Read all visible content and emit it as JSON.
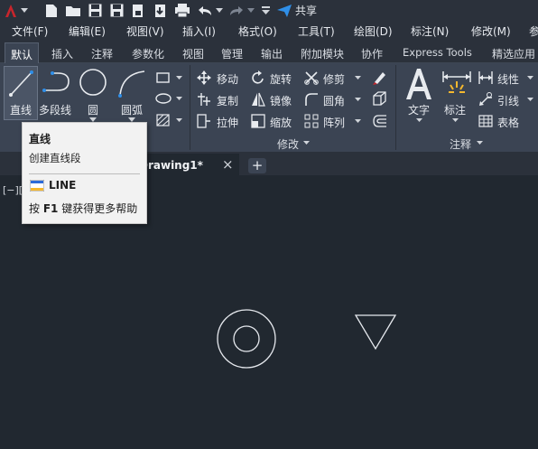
{
  "quick_access": {
    "share_label": "共享",
    "icons": [
      "autocad-logo-icon",
      "new-file-icon",
      "open-folder-icon",
      "save-icon",
      "save-as-icon",
      "print-icon",
      "publish-icon",
      "plot-icon",
      "undo-icon",
      "redo-icon",
      "customize-icon",
      "share-icon"
    ]
  },
  "menu": [
    "文件(F)",
    "编辑(E)",
    "视图(V)",
    "插入(I)",
    "格式(O)",
    "工具(T)",
    "绘图(D)",
    "标注(N)",
    "修改(M)",
    "参"
  ],
  "ribbon_tabs": [
    "默认",
    "插入",
    "注释",
    "参数化",
    "视图",
    "管理",
    "输出",
    "附加模块",
    "协作",
    "Express Tools",
    "精选应用"
  ],
  "draw_panel": {
    "line": "直线",
    "polyline": "多段线",
    "circle": "圆",
    "arc": "圆弧"
  },
  "modify_panel": {
    "title": "修改",
    "move": "移动",
    "rotate": "旋转",
    "trim": "修剪",
    "copy": "复制",
    "mirror": "镜像",
    "fillet": "圆角",
    "stretch": "拉伸",
    "scale": "缩放",
    "array": "阵列"
  },
  "annotation_panel": {
    "title": "注释",
    "text": "文字",
    "dimension": "标注",
    "linear": "线性",
    "leader": "引线",
    "table": "表格"
  },
  "file_tab": {
    "name": "Drawing1*",
    "close": "×",
    "add": "+"
  },
  "viewport": {
    "controls": "[−][",
    "shapes": [
      "circle",
      "circle",
      "triangle"
    ]
  },
  "tooltip": {
    "title": "直线",
    "description": "创建直线段",
    "command": "LINE",
    "help_prefix": "按 ",
    "help_key": "F1",
    "help_suffix": " 键获得更多帮助"
  },
  "colors": {
    "canvas": "#212830",
    "ribbon": "#3b4453",
    "bar": "#2b313b",
    "accent_red": "#c8252c",
    "share_blue": "#2f8fe8",
    "tooltip_bg": "#f2f2f2"
  }
}
